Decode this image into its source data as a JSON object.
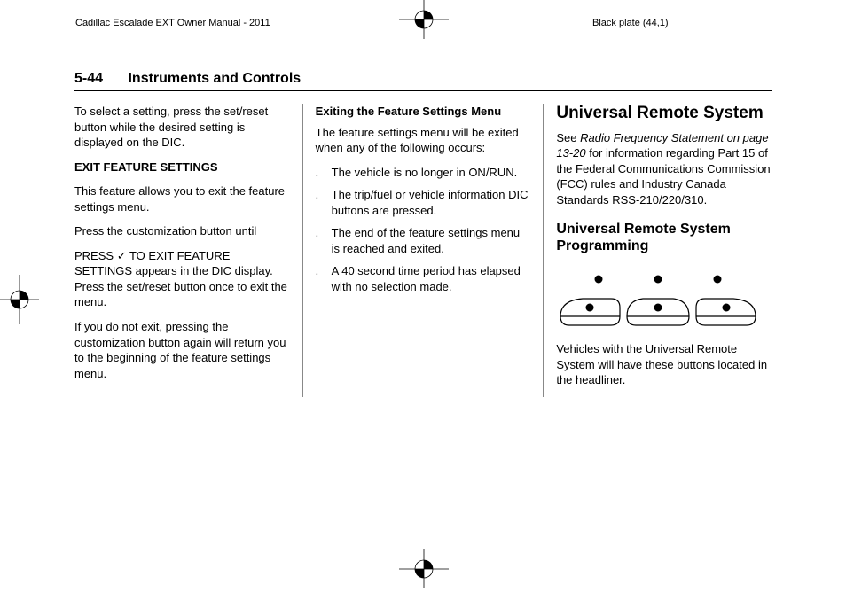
{
  "header": {
    "left": "Cadillac Escalade EXT Owner Manual - 2011",
    "right": "Black plate (44,1)"
  },
  "page": {
    "number": "5-44",
    "title": "Instruments and Controls"
  },
  "col1": {
    "p1": "To select a setting, press the set/reset button while the desired setting is displayed on the DIC.",
    "h1": "EXIT FEATURE SETTINGS",
    "p2": "This feature allows you to exit the feature settings menu.",
    "p3": "Press the customization button until",
    "p4a": "PRESS ",
    "check": "✓",
    "p4b": " TO EXIT FEATURE SETTINGS appears in the DIC display. Press the set/reset button once to exit the menu.",
    "p5": "If you do not exit, pressing the customization button again will return you to the beginning of the feature settings menu."
  },
  "col2": {
    "h1": "Exiting the Feature Settings Menu",
    "p1": "The feature settings menu will be exited when any of the following occurs:",
    "items": [
      "The vehicle is no longer in ON/RUN.",
      "The trip/fuel or vehicle information DIC buttons are pressed.",
      "The end of the feature settings menu is reached and exited.",
      "A 40 second time period has elapsed with no selection made."
    ],
    "bullet": "."
  },
  "col3": {
    "h1": "Universal Remote System",
    "p1a": "See ",
    "p1i": "Radio Frequency Statement on page 13‑20",
    "p1b": " for information regarding Part 15 of the Federal Communications Commission (FCC) rules and Industry Canada Standards RSS-210/220/310.",
    "h2": "Universal Remote System Programming",
    "p2": "Vehicles with the Universal Remote System will have these buttons located in the headliner."
  }
}
